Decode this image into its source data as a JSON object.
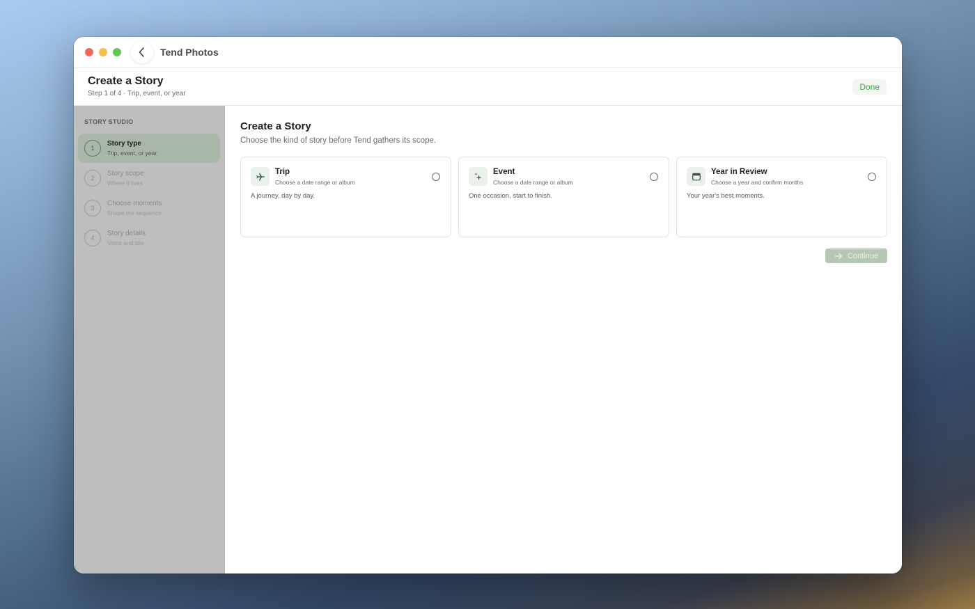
{
  "window": {
    "app_title": "Tend Photos"
  },
  "header": {
    "title": "Create a Story",
    "subtitle": "Step 1 of 4 · Trip, event, or year",
    "done_label": "Done"
  },
  "sidebar": {
    "heading": "STORY STUDIO",
    "steps": [
      {
        "number": "1",
        "title": "Story type",
        "subtitle": "Trip, event, or year",
        "active": true
      },
      {
        "number": "2",
        "title": "Story scope",
        "subtitle": "Where it lives",
        "active": false
      },
      {
        "number": "3",
        "title": "Choose moments",
        "subtitle": "Shape the sequence",
        "active": false
      },
      {
        "number": "4",
        "title": "Story details",
        "subtitle": "Voice and title",
        "active": false
      }
    ]
  },
  "main": {
    "title": "Create a Story",
    "subtitle": "Choose the kind of story before Tend gathers its scope.",
    "cards": [
      {
        "icon": "airplane-icon",
        "title": "Trip",
        "subtitle": "Choose a date range or album",
        "description": "A journey, day by day.",
        "selected": false
      },
      {
        "icon": "sparkles-icon",
        "title": "Event",
        "subtitle": "Choose a date range or album",
        "description": "One occasion, start to finish.",
        "selected": false
      },
      {
        "icon": "calendar-icon",
        "title": "Year in Review",
        "subtitle": "Choose a year and confirm months",
        "description": "Your year's best moments.",
        "selected": false
      }
    ],
    "continue_label": "Continue",
    "continue_enabled": false
  },
  "colors": {
    "accent_green": "#3fa34d",
    "sidebar_bg": "#bebebe",
    "active_step_bg": "#a9b7a9",
    "continue_disabled_bg": "#b4c8b4"
  }
}
